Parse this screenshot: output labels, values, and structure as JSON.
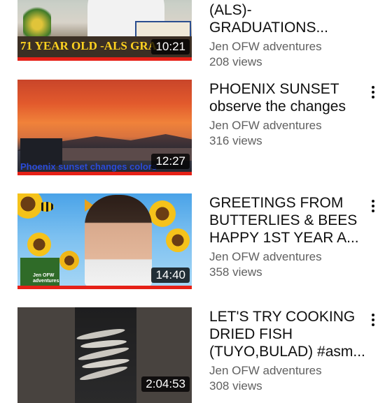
{
  "videos": [
    {
      "title": "(ALS)-GRADUATIONS...",
      "channel": "Jen OFW  adventures",
      "views": "208 views",
      "duration": "10:21",
      "overlay_text": "71 YEAR OLD -ALS GRA"
    },
    {
      "title": "PHOENIX SUNSET\nobserve the changes",
      "channel": "Jen OFW  adventures",
      "views": "316 views",
      "duration": "12:27",
      "overlay_text": "Phoenix sunset changes colors"
    },
    {
      "title": "GREETINGS FROM\nBUTTERLIES & BEES\nHAPPY 1ST YEAR A...",
      "channel": "Jen OFW  adventures",
      "views": "358 views",
      "duration": "14:40",
      "overlay_text": "Jen OFW\nadventures"
    },
    {
      "title": "LET'S TRY COOKING\nDRIED FISH\n(TUYO,BULAD) #asm...",
      "channel": "Jen OFW  adventures",
      "views": "308 views",
      "duration": "2:04:53"
    }
  ],
  "colors": {
    "progress_bar": "#e62117",
    "meta_text": "#606060",
    "title_text": "#0f0f0f"
  },
  "icons": {
    "menu": "more-vert-icon"
  }
}
